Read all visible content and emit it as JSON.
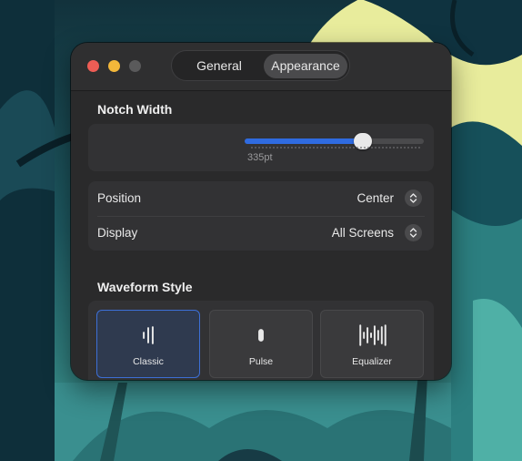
{
  "window": {
    "tabs": [
      {
        "label": "General",
        "selected": false
      },
      {
        "label": "Appearance",
        "selected": true
      }
    ]
  },
  "notch_width": {
    "section_title": "Notch Width",
    "slider_fraction": 0.66,
    "value_label": "335pt"
  },
  "settings_rows": [
    {
      "label": "Position",
      "value": "Center"
    },
    {
      "label": "Display",
      "value": "All Screens"
    }
  ],
  "waveform": {
    "section_title": "Waveform Style",
    "styles": [
      {
        "label": "Classic",
        "icon": "classic-waveform-icon",
        "selected": true
      },
      {
        "label": "Pulse",
        "icon": "pulse-waveform-icon",
        "selected": false
      },
      {
        "label": "Equalizer",
        "icon": "equalizer-waveform-icon",
        "selected": false
      }
    ]
  },
  "colors": {
    "accent": "#2f6be0",
    "window_bg": "#2a2a2b",
    "close": "#ee5d55",
    "minimize": "#f3b73a"
  }
}
